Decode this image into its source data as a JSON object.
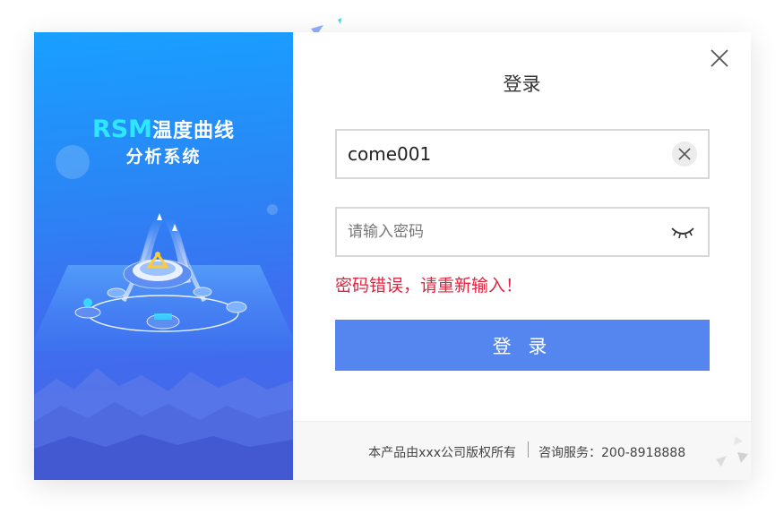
{
  "brand": {
    "logo_text": "RSM",
    "line1_rest": "温度曲线",
    "line2": "分析系统"
  },
  "login": {
    "title": "登录",
    "username_value": "come001",
    "password_placeholder": "请输入密码",
    "error_message": "密码错误，请重新输入！",
    "submit_label": "登 录"
  },
  "footer": {
    "copyright": "本产品由xxx公司版权所有",
    "service": "咨询服务：200-8918888"
  },
  "icons": {
    "close": "close-icon",
    "clear": "clear-icon",
    "password_toggle": "eye-closed-icon"
  },
  "colors": {
    "accent": "#5585ee",
    "error": "#e8223e",
    "brand_cyan": "#2fe6ff",
    "panel_top": "#18a0ff",
    "panel_bottom": "#4a63e6"
  }
}
